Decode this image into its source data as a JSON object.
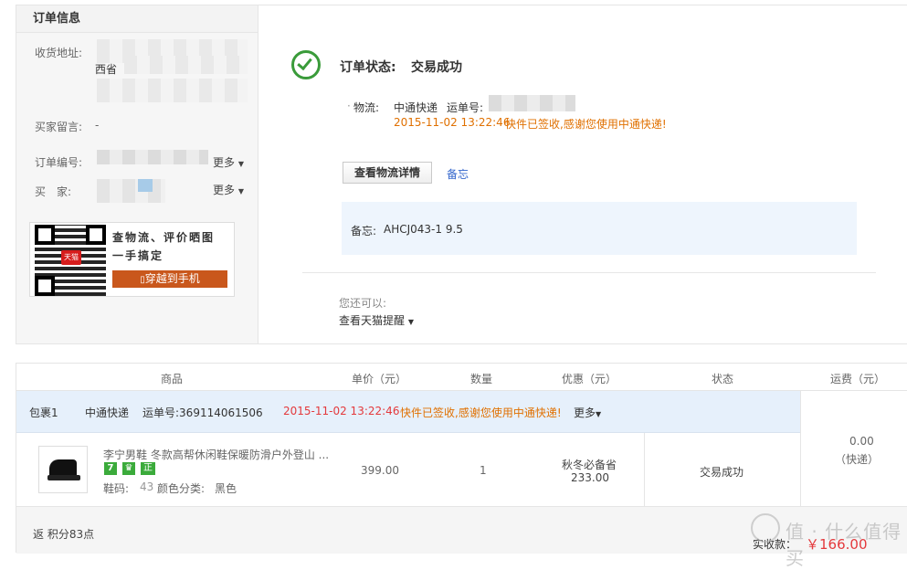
{
  "left": {
    "title": "订单信息",
    "address_label": "收货地址:",
    "address_fragment": "西省",
    "message_label": "买家留言:",
    "message_value": "-",
    "order_no_label": "订单编号:",
    "buyer_label": "买　家:",
    "more_label": "更多",
    "qr_text_1": "查物流、评价晒图",
    "qr_text_2": "一手搞定",
    "qr_badge": "天猫",
    "qr_button": "穿越到手机"
  },
  "status": {
    "title_label": "订单状态:",
    "title_value": "交易成功",
    "logistics_label": "物流:",
    "carrier": "中通快递",
    "waybill_label": "运单号:",
    "datetime": "2015-11-02 13:22:46",
    "message": "快件已签收,感谢您使用中通快递!",
    "view_button": "查看物流详情",
    "note_link": "备忘",
    "note_label": "备忘:",
    "note_value": "AHCJ043-1 9.5",
    "also_label": "您还可以:",
    "reminder_link": "查看天猫提醒"
  },
  "table": {
    "headers": [
      "商品",
      "单价（元）",
      "数量",
      "优惠（元）",
      "状态",
      "运费（元）"
    ],
    "package": {
      "name": "包裹1",
      "carrier": "中通快递",
      "waybill": "运单号:369114061506",
      "datetime": "2015-11-02 13:22:46",
      "message": "快件已签收,感谢您使用中通快递!",
      "more": "更多"
    },
    "item": {
      "title": "李宁男鞋 冬款高帮休闲鞋保暖防滑户外登山 ...",
      "badges": [
        "7",
        "",
        "正"
      ],
      "size_label": "鞋码:",
      "size_value": "43",
      "color_label": "颜色分类:",
      "color_value": "黑色",
      "price": "399.00",
      "quantity": "1",
      "discount_label": "秋冬必备省",
      "discount_value": "233.00",
      "status": "交易成功"
    },
    "shipping_value": "0.00",
    "shipping_type": "（快递）",
    "points": "返 积分83点",
    "paid_label": "实收款：",
    "paid_value": "￥166.00"
  },
  "watermark": "值 · 什么值得买",
  "colors": {
    "success_green": "#3a9b3a",
    "orange_text": "#e07000",
    "red_price": "#e4393c",
    "link_blue": "#3366cc",
    "qr_button_bg": "#c9571c",
    "note_bg": "#eef5fd",
    "package_row_bg": "#e6f0fb"
  }
}
